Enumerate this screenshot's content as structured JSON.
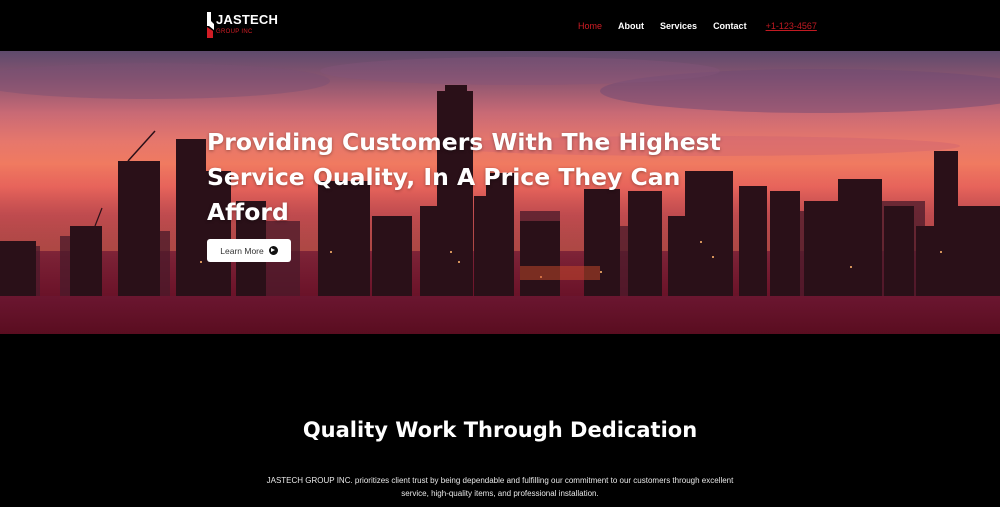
{
  "brand": {
    "name": "JASTECH",
    "sub": "GROUP INC",
    "accent": "#d11d25"
  },
  "nav": {
    "items": [
      "Home",
      "About",
      "Services",
      "Contact"
    ],
    "active": "Home",
    "phone": "+1-123-4567"
  },
  "hero": {
    "title": "Providing Customers With The Highest Service Quality, In A Price They Can Afford",
    "button_label": "Learn More",
    "button_icon": "arrow-circle-right-icon"
  },
  "intro": {
    "title": "Quality Work Through Dedication",
    "text": "JASTECH GROUP INC. prioritizes client trust by being dependable and fulfilling our commitment to our customers through excellent service, high-quality items, and professional installation."
  }
}
